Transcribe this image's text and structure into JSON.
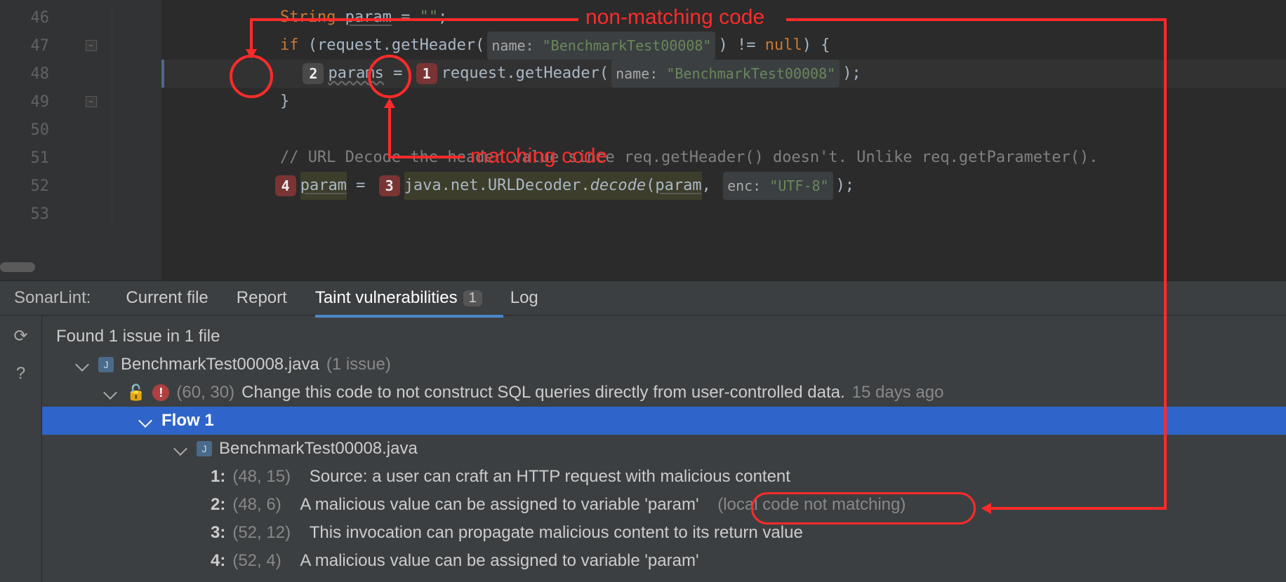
{
  "annotations": {
    "non_matching": "non-matching code",
    "matching": "matching code"
  },
  "editor": {
    "lines": [
      {
        "num": "46"
      },
      {
        "num": "47"
      },
      {
        "num": "48"
      },
      {
        "num": "49"
      },
      {
        "num": "50"
      },
      {
        "num": "51"
      },
      {
        "num": "52"
      },
      {
        "num": "53"
      }
    ],
    "l46": {
      "a": "String ",
      "b": "param",
      "c": " = ",
      "d": "\"\"",
      "e": ";"
    },
    "l47": {
      "a": "if ",
      "b": "(request.getHeader(",
      "hint_k": "name:",
      "hint_v": " \"BenchmarkTest00008\"",
      "c": ") != ",
      "d": "null",
      "e": ") {"
    },
    "l48": {
      "badge2": "2",
      "a": "params",
      "b": " = ",
      "badge1": "1",
      "c": "request.getHeader(",
      "hint_k": "name:",
      "hint_v": " \"BenchmarkTest00008\"",
      "d": ");"
    },
    "l49": {
      "a": "}"
    },
    "l51": {
      "a": "// URL Decode the header value since req.getHeader() doesn't. Unlike req.getParameter()."
    },
    "l52": {
      "badge4": "4",
      "a": "param",
      "b": " = ",
      "badge3": "3",
      "c": "java.net.URLDecoder.",
      "d": "decode",
      "e": "(",
      "f": "param",
      "g": ", ",
      "hint_k": "enc:",
      "hint_v": " \"UTF-8\"",
      "h": ");"
    }
  },
  "panel": {
    "title": "SonarLint:",
    "tabs": {
      "current": "Current file",
      "report": "Report",
      "taint": "Taint vulnerabilities",
      "taint_count": "1",
      "log": "Log"
    },
    "summary": "Found 1 issue in 1 file",
    "file": "BenchmarkTest00008.java",
    "file_issues": "(1 issue)",
    "issue": {
      "loc": "(60, 30)",
      "msg": "Change this code to not construct SQL queries directly from user-controlled data.",
      "age": "15 days ago"
    },
    "flow": "Flow 1",
    "flow_file": "BenchmarkTest00008.java",
    "steps": {
      "s1": {
        "n": "1:",
        "loc": "(48, 15)",
        "msg": "Source: a user can craft an HTTP request with malicious content"
      },
      "s2": {
        "n": "2:",
        "loc": "(48, 6)",
        "msg": "A malicious value can be assigned to variable 'param'",
        "extra": "(local code not matching)"
      },
      "s3": {
        "n": "3:",
        "loc": "(52, 12)",
        "msg": "This invocation can propagate malicious content to its return value"
      },
      "s4": {
        "n": "4:",
        "loc": "(52, 4)",
        "msg": "A malicious value can be assigned to variable 'param'"
      }
    }
  }
}
